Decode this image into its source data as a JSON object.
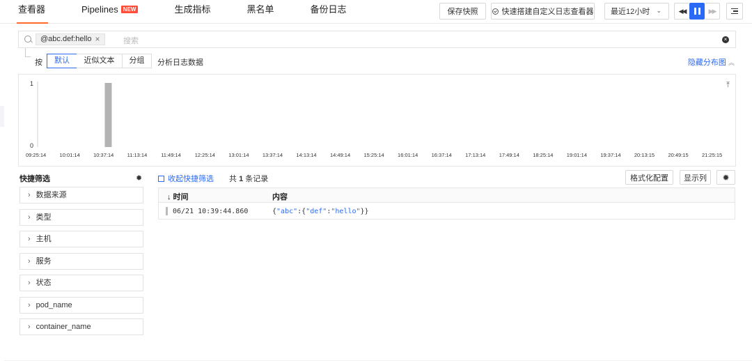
{
  "tabs": [
    {
      "label": "查看器",
      "active": true
    },
    {
      "label": "Pipelines",
      "badge": "NEW"
    },
    {
      "label": "生成指标"
    },
    {
      "label": "黑名单"
    },
    {
      "label": "备份日志"
    }
  ],
  "toolbar": {
    "save_snapshot": "保存快照",
    "quick_build": "快速搭建自定义日志查看器",
    "time_range": "最近12小时"
  },
  "search": {
    "chip": "@abc.def:hello",
    "placeholder": "搜索"
  },
  "groupby": {
    "label": "按",
    "options": [
      "默认",
      "近似文本",
      "分组"
    ],
    "selected": "默认",
    "analyze": "分析日志数据",
    "hide_dist": "隐藏分布图"
  },
  "chart_data": {
    "type": "bar",
    "ylim": [
      0,
      1
    ],
    "yticks": [
      "1",
      "0"
    ],
    "ticks": [
      "09:25:14",
      "10:01:14",
      "10:37:14",
      "11:13:14",
      "11:49:14",
      "12:25:14",
      "13:01:14",
      "13:37:14",
      "14:13:14",
      "14:49:14",
      "15:25:14",
      "16:01:14",
      "16:37:14",
      "17:13:14",
      "17:49:14",
      "18:25:14",
      "19:01:14",
      "19:37:14",
      "20:13:15",
      "20:49:15",
      "21:25:15"
    ],
    "series": [
      {
        "x": "10:39:44",
        "value": 1
      }
    ],
    "bar_color": "#b3b3b3"
  },
  "quick_filter": {
    "title": "快捷筛选",
    "items": [
      "数据来源",
      "类型",
      "主机",
      "服务",
      "状态",
      "pod_name",
      "container_name"
    ]
  },
  "logs": {
    "collapse": "收起快捷筛选",
    "total_prefix": "共",
    "total_count": "1",
    "total_suffix": "条记录",
    "format_config": "格式化配置",
    "show_columns": "显示列",
    "col_time": "↓ 时间",
    "col_content": "内容",
    "rows": [
      {
        "time": "06/21 10:39:44.860",
        "content": "{\"abc\":{\"def\":\"hello\"}}"
      }
    ]
  },
  "colors": {
    "accent": "#2b6af5",
    "tab_underline": "#ff6a2b",
    "new_badge": "#ff4d3a"
  }
}
